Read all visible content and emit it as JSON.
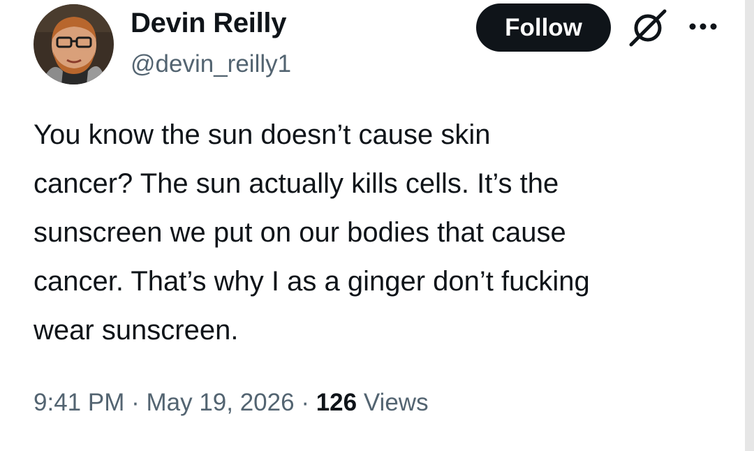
{
  "author": {
    "display_name": "Devin Reilly",
    "handle": "@devin_reilly1",
    "avatar_icon": "profile-photo"
  },
  "actions": {
    "follow_label": "Follow",
    "grok_icon": "grok-icon",
    "more_icon": "more-options-icon"
  },
  "tweet": {
    "text": "You know the sun doesn’t cause skin\ncancer? The sun actually kills cells. It’s the\nsunscreen we put on our bodies that cause\ncancer. That’s why I as a ginger don’t fucking\nwear sunscreen."
  },
  "meta": {
    "time": "9:41 PM",
    "separator": "·",
    "date": "May 19, 2026",
    "views_count": "126",
    "views_label": "Views"
  },
  "colors": {
    "text_primary": "#0f1419",
    "text_secondary": "#536471",
    "follow_button_bg": "#0f1419",
    "follow_button_text": "#ffffff"
  }
}
